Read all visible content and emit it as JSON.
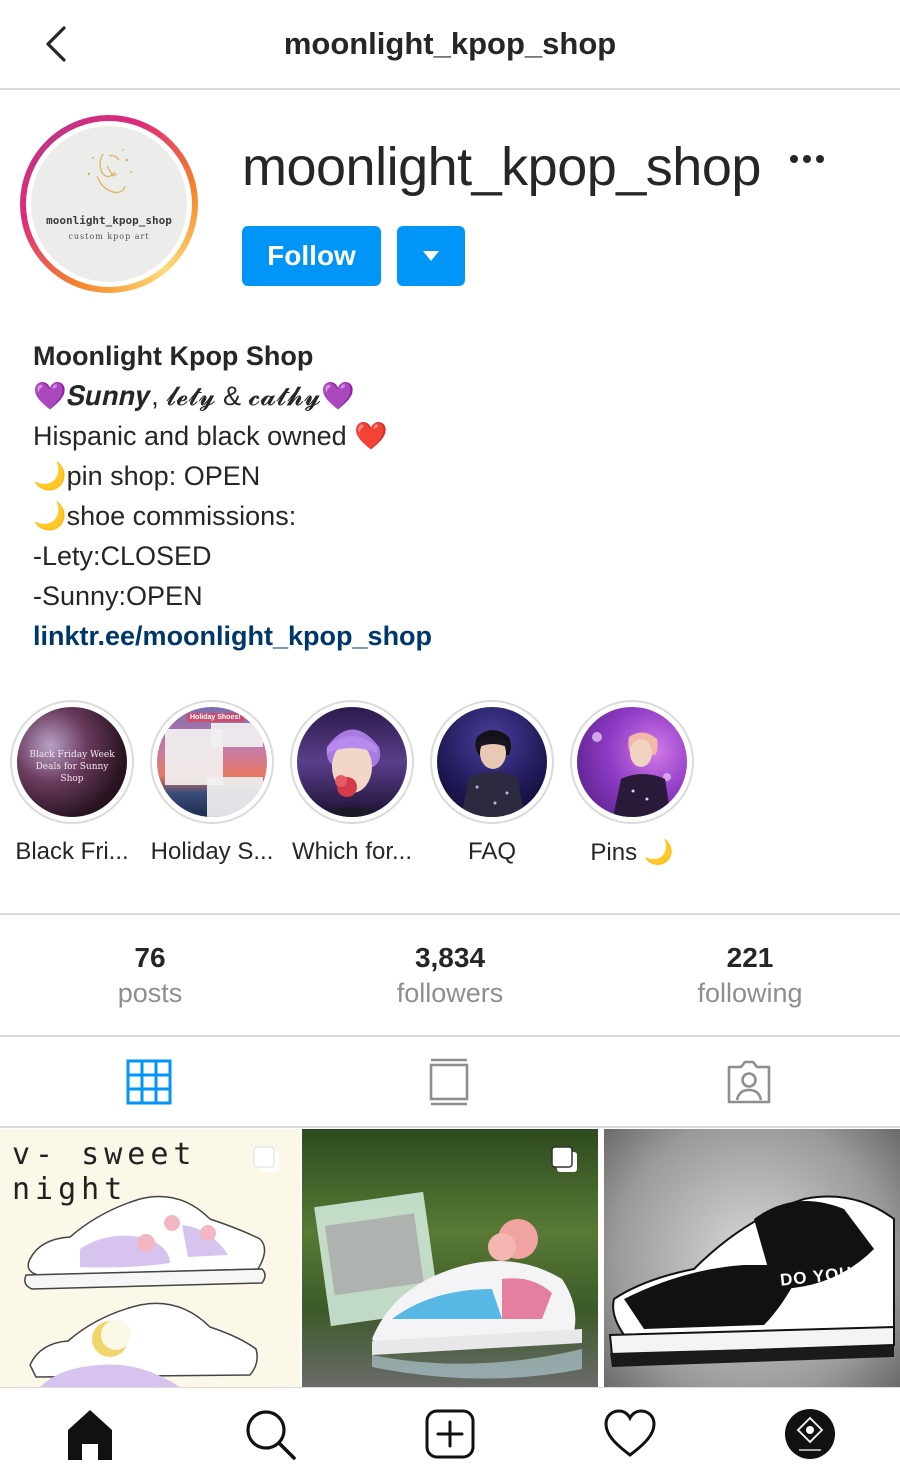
{
  "header": {
    "title": "moonlight_kpop_shop"
  },
  "profile": {
    "username": "moonlight_kpop_shop",
    "avatar_text": "moonlight_kpop_shop",
    "avatar_subtext": "custom kpop art",
    "follow_label": "Follow"
  },
  "bio": {
    "name": "Moonlight Kpop Shop",
    "line1": "💜𝑺𝒖𝒏𝒏𝒚, 𝓵𝓮𝓽𝔂 & 𝓬𝓪𝓽𝓱𝔂💜",
    "line1_plain": "Sunny, lety & cathy",
    "line2": "Hispanic and black owned ❤️",
    "line3": "🌙pin shop: OPEN",
    "line4": "🌙shoe commissions:",
    "line5": "-Lety:CLOSED",
    "line6": "-Sunny:OPEN",
    "link": "linktr.ee/moonlight_kpop_shop"
  },
  "highlights": [
    {
      "label": "Black Fri...",
      "cover_text": "Black Friday Week Deals for Sunny Shop"
    },
    {
      "label": "Holiday S...",
      "cover_text": "Holiday Shoes!"
    },
    {
      "label": "Which for..."
    },
    {
      "label": "FAQ"
    },
    {
      "label": "Pins 🌙"
    }
  ],
  "stats": {
    "posts": {
      "value": "76",
      "label": "posts"
    },
    "followers": {
      "value": "3,834",
      "label": "followers"
    },
    "following": {
      "value": "221",
      "label": "following"
    }
  },
  "tabs": [
    "grid",
    "feed",
    "tagged"
  ],
  "posts": [
    {
      "caption_overlay": "v- sweet night",
      "multi": true
    },
    {
      "caption_overlay": "",
      "multi": true
    },
    {
      "caption_overlay": "DO YOU",
      "multi": false
    }
  ],
  "nav": [
    "home",
    "search",
    "new-post",
    "activity",
    "profile"
  ],
  "colors": {
    "accent": "#0095f6",
    "link": "#00376b",
    "text": "#262626",
    "muted": "#8e8e8e",
    "border": "#dbdbdb"
  }
}
